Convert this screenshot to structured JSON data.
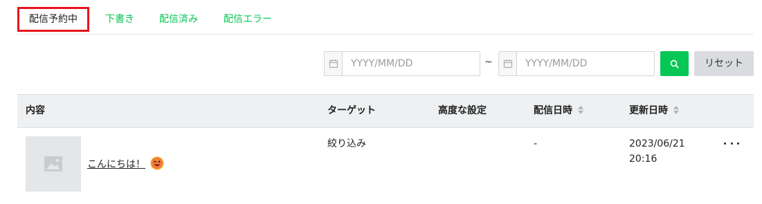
{
  "tabs": [
    {
      "label": "配信予約中",
      "active": true
    },
    {
      "label": "下書き",
      "active": false
    },
    {
      "label": "配信済み",
      "active": false
    },
    {
      "label": "配信エラー",
      "active": false
    }
  ],
  "filters": {
    "start_date": {
      "placeholder": "YYYY/MM/DD",
      "value": "",
      "icon": "calendar-icon"
    },
    "separator": "~",
    "end_date": {
      "placeholder": "YYYY/MM/DD",
      "value": "",
      "icon": "calendar-icon"
    },
    "search_icon": "search-icon",
    "reset_label": "リセット"
  },
  "table": {
    "columns": [
      "内容",
      "ターゲット",
      "高度な設定",
      "配信日時",
      "更新日時"
    ],
    "rows": [
      {
        "thumbnail_icon": "image-placeholder-icon",
        "content": "こんにちは！",
        "content_emoji": "winking-face-emoji",
        "target": "絞り込み",
        "advanced": "",
        "delivery_datetime": "-",
        "updated_date": "2023/06/21",
        "updated_time": "20:16"
      }
    ]
  },
  "colors": {
    "accent": "#06c755",
    "active_tab_border": "#e8121b",
    "header_bg": "#eef0f2",
    "reset_bg": "#d9dbde"
  }
}
